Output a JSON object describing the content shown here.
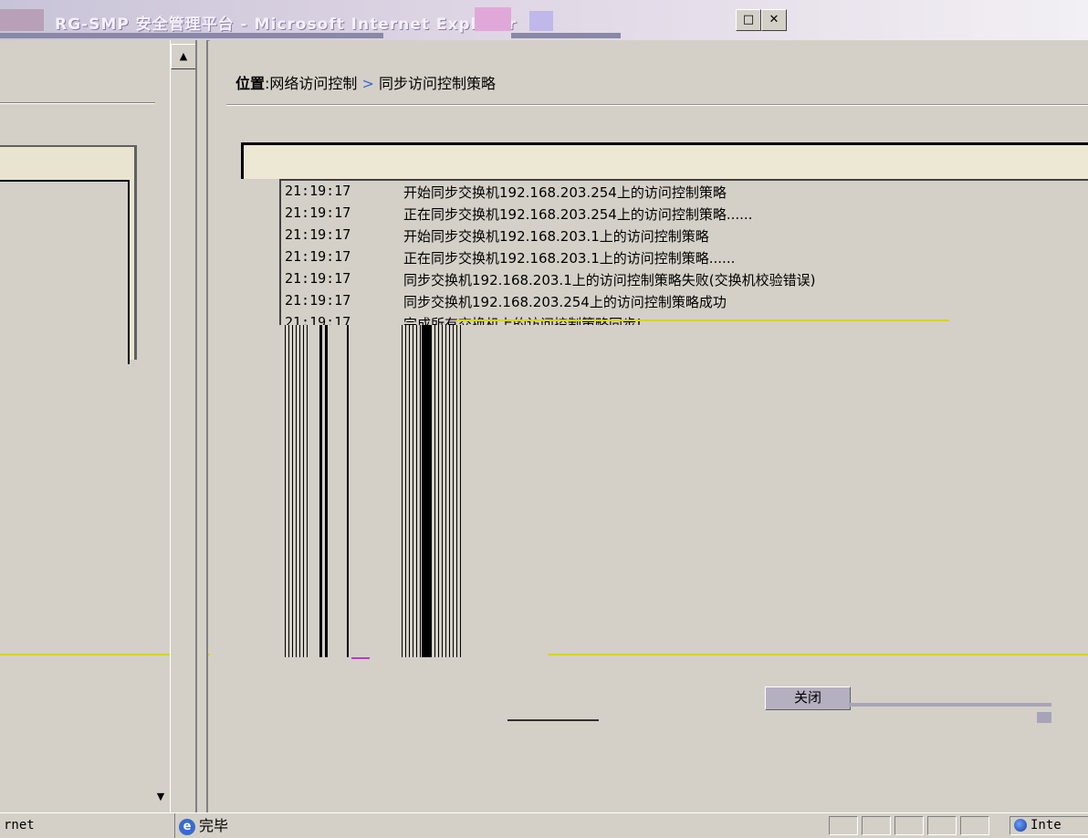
{
  "window": {
    "title": "RG-SMP 安全管理平台 - Microsoft Internet Explorer",
    "controls": {
      "minimize": "_",
      "restore": "□",
      "close": "✕"
    }
  },
  "breadcrumb": {
    "label": "位置",
    "separator": ":",
    "section": "网络访问控制",
    "arrow": ">",
    "page": "同步访问控制策略"
  },
  "log": {
    "entries": [
      {
        "time": "21:19:17",
        "message": "开始同步交换机192.168.203.254上的访问控制策略"
      },
      {
        "time": "21:19:17",
        "message": "正在同步交换机192.168.203.254上的访问控制策略......"
      },
      {
        "time": "21:19:17",
        "message": "开始同步交换机192.168.203.1上的访问控制策略"
      },
      {
        "time": "21:19:17",
        "message": "正在同步交换机192.168.203.1上的访问控制策略......"
      },
      {
        "time": "21:19:17",
        "message": "同步交换机192.168.203.1上的访问控制策略失败(交换机校验错误)"
      },
      {
        "time": "21:19:17",
        "message": "同步交换机192.168.203.254上的访问控制策略成功"
      },
      {
        "time": "21:19:17",
        "message": "完成所有交换机上的访问控制策略同步!"
      }
    ]
  },
  "actions": {
    "close_label": "关闭"
  },
  "statusbar": {
    "left_text": "rnet",
    "main_text": "完毕",
    "zone_text": "Inte"
  },
  "colors": {
    "background": "#d4d0c8",
    "accent": "#3a6ad0",
    "glitch_yellow": "#d8d400"
  }
}
